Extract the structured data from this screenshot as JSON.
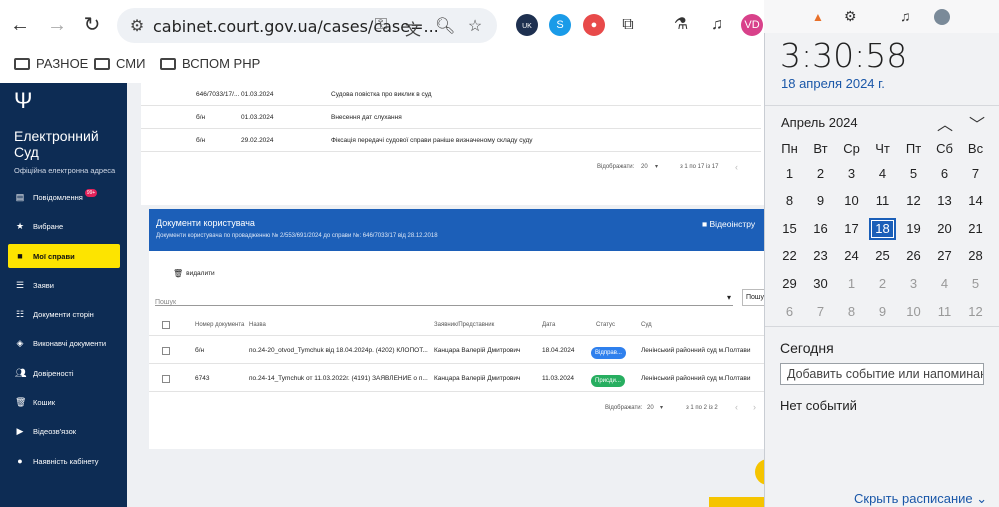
{
  "browser": {
    "url": "cabinet.court.gov.ua/cases/case=...",
    "profile_initials": "VD",
    "ext_badge": "UK"
  },
  "bookmarks": [
    "РАЗНОЕ",
    "СМИ",
    "ВСПОМ PHP"
  ],
  "sidebar": {
    "brand_line1": "Електронний",
    "brand_line2": "Суд",
    "subtitle": "Офіційна електронна адреса",
    "items": [
      {
        "label": "Повідомлення",
        "icon": "message-icon",
        "badge": "99+"
      },
      {
        "label": "Вибране",
        "icon": "star-icon"
      },
      {
        "label": "Мої справи",
        "icon": "folder-icon",
        "active": true
      },
      {
        "label": "Заяви",
        "icon": "list-icon"
      },
      {
        "label": "Документи сторін",
        "icon": "checklist-icon"
      },
      {
        "label": "Виконавчі документи",
        "icon": "layers-icon"
      },
      {
        "label": "Довіреності",
        "icon": "people-icon"
      },
      {
        "label": "Кошик",
        "icon": "trash-icon"
      },
      {
        "label": "Відеозв'язок",
        "icon": "video-icon"
      },
      {
        "label": "Наявність кабінету",
        "icon": "person-icon"
      }
    ]
  },
  "case_docs": {
    "rows": [
      {
        "number": "646/7033/17/...",
        "date": "01.03.2024",
        "name": "Судова повістка про виклик в суд"
      },
      {
        "number": "б/н",
        "date": "01.03.2024",
        "name": "Внесення дат слухання"
      },
      {
        "number": "б/н",
        "date": "29.02.2024",
        "name": "Фіксація передачі судової справи раніше визначеному складу суду"
      }
    ],
    "pagination": {
      "label": "Відображати:",
      "per_page": "20",
      "range": "з 1 по 17 із 17"
    }
  },
  "user_docs": {
    "title": "Документи користувача",
    "subtitle": "Документи користувача по провадженню № 2/553/691/2024 до справи №: 646/7033/17 від 28.12.2018",
    "video_label": "Відеоінстру",
    "delete_label": "видалити",
    "search_placeholder": "Пошук",
    "search_right": "Пошу",
    "columns": [
      "Номер документа",
      "Назва",
      "Заявник/Представник",
      "Дата",
      "Статус",
      "Суд"
    ],
    "rows": [
      {
        "number": "б/н",
        "name": "по.24-20_otvod_Tymchuk від 18.04.2024р. (4202) КЛОПОТ...",
        "applicant": "Канцара Валерій Дмитрович",
        "date": "18.04.2024",
        "status": "Відправ...",
        "status_color": "#2f80ed",
        "court": "Ленінський районний суд м.Полтави"
      },
      {
        "number": "6743",
        "name": "по.24-14_Tymchuk от 11.03.2022г. (4191) ЗАЯВЛЕНИЕ о п...",
        "applicant": "Канцара Валерій Дмитрович",
        "date": "11.03.2024",
        "status": "Присди...",
        "status_color": "#27ae60",
        "court": "Ленінський районний суд м.Полтави"
      }
    ],
    "pagination": {
      "label": "Відображати:",
      "per_page": "20",
      "range": "з 1 по 2 із 2"
    }
  },
  "calendar": {
    "time": "3:30:58",
    "date": "18 апреля 2024 г.",
    "month": "Апрель 2024",
    "weekdays": [
      "Пн",
      "Вт",
      "Ср",
      "Чт",
      "Пт",
      "Сб",
      "Вс"
    ],
    "weeks": [
      [
        "1",
        "2",
        "3",
        "4",
        "5",
        "6",
        "7"
      ],
      [
        "8",
        "9",
        "10",
        "11",
        "12",
        "13",
        "14"
      ],
      [
        "15",
        "16",
        "17",
        "18",
        "19",
        "20",
        "21"
      ],
      [
        "22",
        "23",
        "24",
        "25",
        "26",
        "27",
        "28"
      ],
      [
        "29",
        "30",
        "1",
        "2",
        "3",
        "4",
        "5"
      ],
      [
        "6",
        "7",
        "8",
        "9",
        "10",
        "11",
        "12"
      ]
    ],
    "today": "18",
    "today_label": "Сегодня",
    "event_placeholder": "Добавить событие или напоминание",
    "no_events": "Нет событий",
    "hide_label": "Скрыть расписание"
  }
}
